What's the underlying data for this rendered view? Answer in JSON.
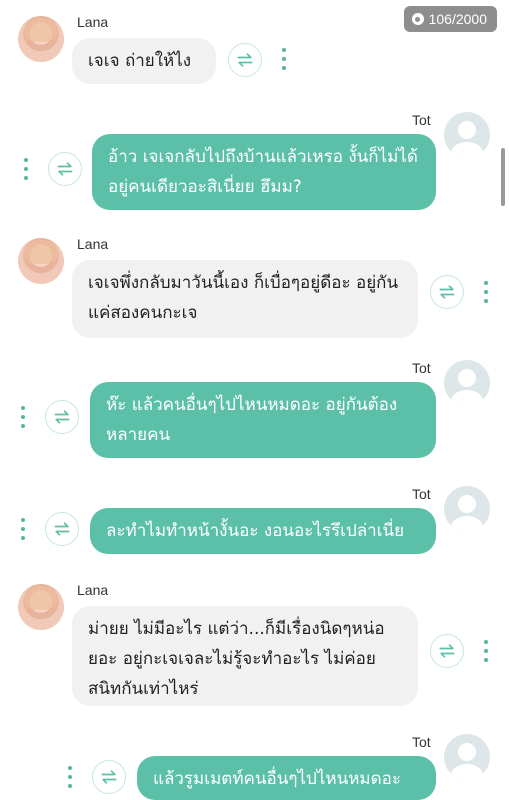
{
  "counter": {
    "text": "106/2000"
  },
  "messages": [
    {
      "sender": "Lana",
      "side": "left",
      "text": "เจเจ ถ่ายให้ไง"
    },
    {
      "sender": "Tot",
      "side": "right",
      "text": "อ้าว เจเจกลับไปถึงบ้านแล้วเหรอ งั้นก็ไม่ได้อยู่คนเดียวอะสิเนี่ยย ฮึมม?"
    },
    {
      "sender": "Lana",
      "side": "left",
      "text": "เจเจพึ่งกลับมาวันนี้เอง ก็เบื่อๆอยู่ดีอะ อยู่กันแค่สองคนกะเจ"
    },
    {
      "sender": "Tot",
      "side": "right",
      "text": "ห๊ะ แล้วคนอื่นๆไปไหนหมดอะ อยู่กันต้องหลายคน"
    },
    {
      "sender": "Tot",
      "side": "right",
      "text": "ละทำไมทำหน้างั้นอะ งอนอะไรรึเปล่าเนี่ย"
    },
    {
      "sender": "Lana",
      "side": "left",
      "text": "ม่ายย ไม่มีอะไร แต่ว่า...ก็มีเรื่องนิดๆหน่อยอะ อยู่กะเจเจละไม่รู้จะทำอะไร ไม่ค่อยสนิทกันเท่าไหร่"
    },
    {
      "sender": "Tot",
      "side": "right",
      "text": "แล้วรูมเมตท์คนอื่นๆไปไหนหมดอะ"
    }
  ],
  "colors": {
    "accent": "#5cc0a8",
    "left_bubble": "#f1f1f1"
  },
  "icons": {
    "swap": "swap-arrows-icon",
    "more": "more-vertical-icon",
    "counter": "counter-dot-icon"
  }
}
